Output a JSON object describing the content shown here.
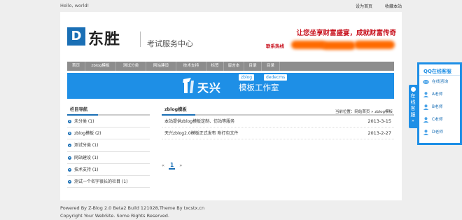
{
  "topbar": {
    "greeting": "Hello, world!",
    "set_home": "设为首页",
    "bookmark": "收藏本站"
  },
  "header": {
    "logo_letter": "D",
    "site_name": "东胜",
    "subtitle": "考试服务中心",
    "slogan": "让您坐享财富盛宴，成就财富传奇",
    "hotline_label": "联系热线",
    "hotline_value": "",
    "colors": {
      "brand": "#1a6fb5",
      "slogan": "#c8101c",
      "redaction": "#ff6a00"
    }
  },
  "nav": {
    "items": [
      "首页",
      "zblog模板",
      "测试分类",
      "网站建设",
      "技术支持",
      "标签",
      "留言本",
      "目录",
      "目录"
    ]
  },
  "banner": {
    "brand": "天兴",
    "tag1": "zblog",
    "tag2": "dedecms",
    "title": "模板工作室",
    "colors": {
      "background": "#1e8fe6"
    }
  },
  "sidebar": {
    "title": "栏目导航",
    "items": [
      "未分类 (1)",
      "zblog模板 (2)",
      "测试分类 (1)",
      "网站建设 (1)",
      "技术支持 (1)",
      "测试一个名字很长的栏目 (1)"
    ]
  },
  "main": {
    "title": "zblog模板",
    "breadcrumb": "当前位置：网站首页 » zblog模板",
    "posts": [
      {
        "title": "本站提供zblog模板定制、仿站等服务",
        "date": "2013-3-15"
      },
      {
        "title": "天兴zblog2.0模板正式发布 附打包文件",
        "date": "2013-2-27"
      }
    ],
    "pager": {
      "prev": "«",
      "current": "1",
      "next": "»"
    }
  },
  "footer": {
    "line1": "Powered By Z-Blog 2.0 Beta2 Build 121028,Theme By txcstx.cn",
    "line2": "Copyright Your WebSite. Some Rights Reserved."
  },
  "qq_widget": {
    "tab_label": "在线客服",
    "tab_arrow": "»",
    "title": "QQ在线客服",
    "items": [
      "在线咨询",
      "A老师",
      "B老师",
      "C老师",
      "D老师"
    ],
    "icons": [
      "qq-chat-icon",
      "person-icon",
      "person-icon",
      "person-icon",
      "person-icon"
    ]
  }
}
